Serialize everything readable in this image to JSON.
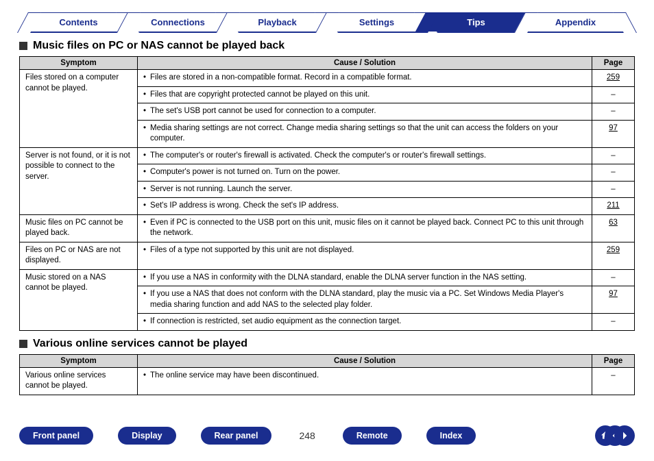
{
  "tabs": [
    {
      "label": "Contents",
      "active": false
    },
    {
      "label": "Connections",
      "active": false
    },
    {
      "label": "Playback",
      "active": false
    },
    {
      "label": "Settings",
      "active": false
    },
    {
      "label": "Tips",
      "active": true
    },
    {
      "label": "Appendix",
      "active": false
    }
  ],
  "section1": {
    "title": "Music files on PC or NAS cannot be played back",
    "headers": {
      "symptom": "Symptom",
      "cause": "Cause / Solution",
      "page": "Page"
    },
    "groups": [
      {
        "symptom": "Files stored on a computer cannot be played.",
        "rows": [
          {
            "text": "Files are stored in a non-compatible format. Record in a compatible format.",
            "page": "259",
            "link": true
          },
          {
            "text": "Files that are copyright protected cannot be played on this unit.",
            "page": "–",
            "link": false
          },
          {
            "text": "The set's USB port cannot be used for connection to a computer.",
            "page": "–",
            "link": false
          },
          {
            "text": "Media sharing settings are not correct. Change media sharing settings so that the unit can access the folders on your computer.",
            "page": "97",
            "link": true
          }
        ]
      },
      {
        "symptom": "Server is not found, or it is not possible to connect to the server.",
        "rows": [
          {
            "text": "The computer's or router's firewall is activated. Check the computer's or router's firewall settings.",
            "page": "–",
            "link": false
          },
          {
            "text": "Computer's power is not turned on. Turn on the power.",
            "page": "–",
            "link": false
          },
          {
            "text": "Server is not running. Launch the server.",
            "page": "–",
            "link": false
          },
          {
            "text": "Set's IP address is wrong. Check the set's IP address.",
            "page": "211",
            "link": true
          }
        ]
      },
      {
        "symptom": "Music files on PC cannot be played back.",
        "rows": [
          {
            "text": "Even if PC is connected to the USB port on this unit, music files on it cannot be played back. Connect PC to this unit through the network.",
            "page": "63",
            "link": true
          }
        ]
      },
      {
        "symptom": "Files on PC or NAS are not displayed.",
        "rows": [
          {
            "text": "Files of a type not supported by this unit are not displayed.",
            "page": "259",
            "link": true
          }
        ]
      },
      {
        "symptom": "Music stored on a NAS cannot be played.",
        "rows": [
          {
            "text": "If you use a NAS in conformity with the DLNA standard, enable the DLNA server function in the NAS setting.",
            "page": "–",
            "link": false
          },
          {
            "text": "If you use a NAS that does not conform with the DLNA standard, play the music via a PC. Set Windows Media Player's media sharing function and add NAS to the selected play folder.",
            "page": "97",
            "link": true
          },
          {
            "text": "If connection is restricted, set audio equipment as the connection target.",
            "page": "–",
            "link": false
          }
        ]
      }
    ]
  },
  "section2": {
    "title": "Various online services cannot be played",
    "headers": {
      "symptom": "Symptom",
      "cause": "Cause / Solution",
      "page": "Page"
    },
    "groups": [
      {
        "symptom": "Various online services cannot be played.",
        "rows": [
          {
            "text": "The online service may have been discontinued.",
            "page": "–",
            "link": false
          }
        ]
      }
    ]
  },
  "bottomNav": {
    "buttons": [
      "Front panel",
      "Display",
      "Rear panel"
    ],
    "pageNumber": "248",
    "buttons2": [
      "Remote",
      "Index"
    ]
  }
}
